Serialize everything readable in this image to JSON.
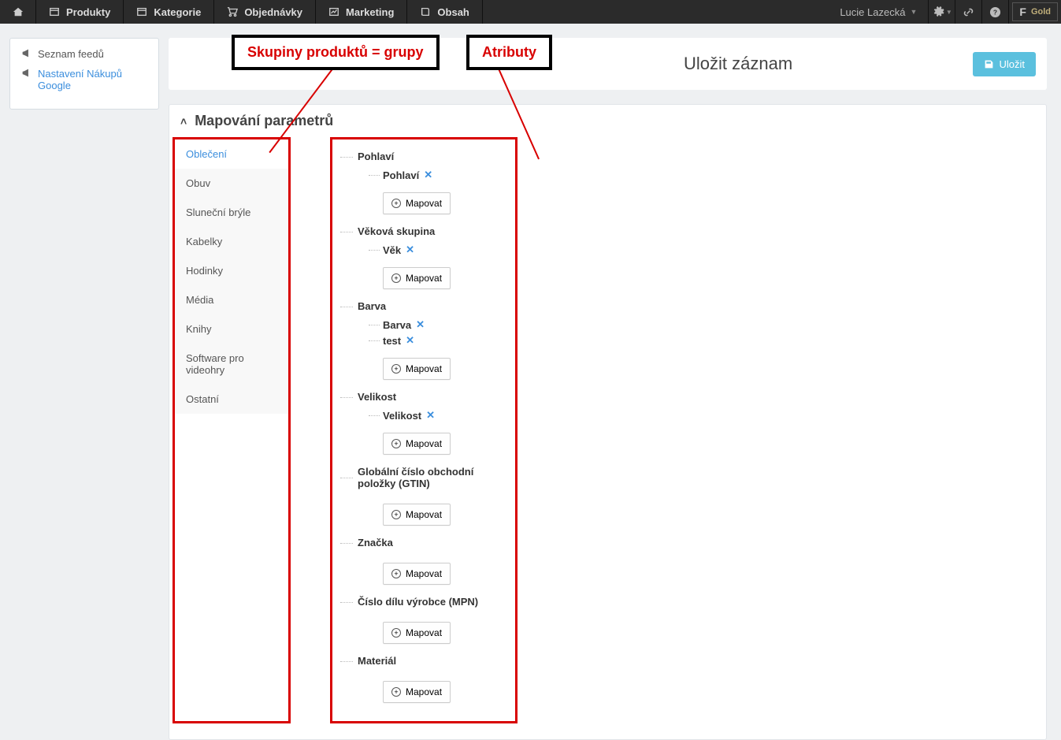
{
  "topnav": {
    "items": [
      {
        "label": "Produkty"
      },
      {
        "label": "Kategorie"
      },
      {
        "label": "Objednávky"
      },
      {
        "label": "Marketing"
      },
      {
        "label": "Obsah"
      }
    ],
    "user": "Lucie Lazecká",
    "plan": "Gold"
  },
  "sidebar": {
    "feeds": "Seznam feedů",
    "settings": "Nastavení Nákupů Google"
  },
  "titlebar": {
    "title": "Uložit záznam",
    "save": "Uložit"
  },
  "annotations": {
    "groups": "Skupiny produktů = grupy",
    "attrs": "Atributy"
  },
  "panel": {
    "heading": "Mapování parametrů",
    "categories": [
      "Oblečení",
      "Obuv",
      "Sluneční brýle",
      "Kabelky",
      "Hodinky",
      "Média",
      "Knihy",
      "Software pro videohry",
      "Ostatní"
    ],
    "active_category_index": 0,
    "map_label": "Mapovat",
    "attributes": [
      {
        "name": "Pohlaví",
        "mapped": [
          "Pohlaví"
        ]
      },
      {
        "name": "Věková skupina",
        "mapped": [
          "Věk"
        ]
      },
      {
        "name": "Barva",
        "mapped": [
          "Barva",
          "test"
        ]
      },
      {
        "name": "Velikost",
        "mapped": [
          "Velikost"
        ]
      },
      {
        "name": "Globální číslo obchodní položky (GTIN)",
        "mapped": []
      },
      {
        "name": "Značka",
        "mapped": []
      },
      {
        "name": "Číslo dílu výrobce (MPN)",
        "mapped": []
      },
      {
        "name": "Materiál",
        "mapped": []
      }
    ]
  }
}
